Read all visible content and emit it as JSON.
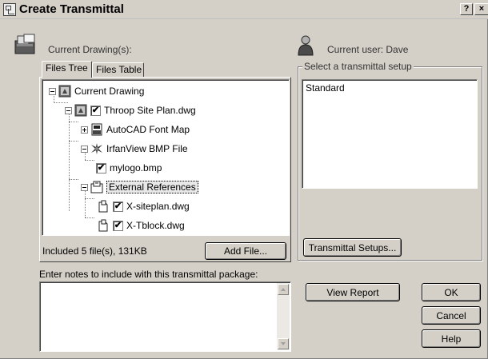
{
  "window": {
    "title": "Create Transmittal",
    "help_btn": "?",
    "close_btn": "×"
  },
  "left": {
    "current_drawings_label": "Current Drawing(s):",
    "tabs": [
      {
        "label": "Files Tree",
        "active": true
      },
      {
        "label": "Files Table",
        "active": false
      }
    ],
    "tree": [
      {
        "label": "Current Drawing",
        "level": 0,
        "expander": "minus",
        "checkbox": false,
        "icon": "drawing-set-icon"
      },
      {
        "label": "Throop Site Plan.dwg",
        "level": 1,
        "expander": "minus",
        "checkbox": true,
        "checked": true,
        "icon": "dwg-file-icon"
      },
      {
        "label": "AutoCAD Font Map",
        "level": 2,
        "expander": "plus",
        "checkbox": false,
        "icon": "font-map-icon"
      },
      {
        "label": "IrfanView BMP File",
        "level": 2,
        "expander": "minus",
        "checkbox": false,
        "icon": "irfanview-icon"
      },
      {
        "label": "mylogo.bmp",
        "level": 3,
        "expander": null,
        "checkbox": true,
        "checked": true,
        "icon": null
      },
      {
        "label": "External References",
        "level": 2,
        "expander": "minus",
        "checkbox": false,
        "icon": "xref-folder-icon",
        "selected": true
      },
      {
        "label": "X-siteplan.dwg",
        "level": 3,
        "expander": null,
        "checkbox": true,
        "checked": true,
        "icon": "xref-file-icon"
      },
      {
        "label": "X-Tblock.dwg",
        "level": 3,
        "expander": null,
        "checkbox": true,
        "checked": true,
        "icon": "xref-file-icon"
      }
    ],
    "included_summary": "Included 5 file(s), 131KB",
    "add_file_button": "Add File...",
    "notes_label": "Enter notes to include with this transmittal package:",
    "notes_value": ""
  },
  "right": {
    "current_user_label": "Current user: Dave",
    "setup_group_label": "Select a transmittal setup",
    "setups": [
      "Standard"
    ],
    "transmittal_setups_button": "Transmittal Setups...",
    "view_report_button": "View Report",
    "ok_button": "OK",
    "cancel_button": "Cancel",
    "help_button": "Help"
  },
  "checkmark": "✔"
}
